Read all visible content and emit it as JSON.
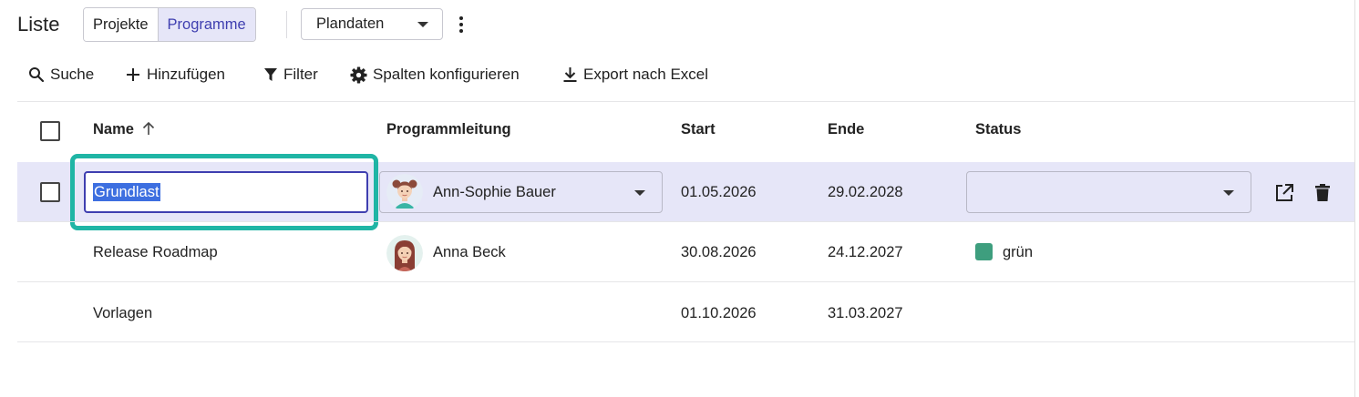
{
  "header": {
    "title": "Liste",
    "segments": [
      "Projekte",
      "Programme"
    ],
    "active_segment": "Programme",
    "view_select": "Plandaten"
  },
  "toolbar": {
    "search": "Suche",
    "add": "Hinzufügen",
    "filter": "Filter",
    "columns": "Spalten konfigurieren",
    "export": "Export nach Excel"
  },
  "table": {
    "columns": {
      "name": "Name",
      "lead": "Programmleitung",
      "start": "Start",
      "end": "Ende",
      "status": "Status"
    },
    "sort": {
      "column": "Name",
      "direction": "ascending"
    },
    "rows": [
      {
        "name": "Grundlast",
        "lead": "Ann-Sophie Bauer",
        "start": "01.05.2026",
        "end": "29.02.2028",
        "status": "",
        "editing": true
      },
      {
        "name": "Release Roadmap",
        "lead": "Anna Beck",
        "start": "30.08.2026",
        "end": "24.12.2027",
        "status": "grün",
        "editing": false
      },
      {
        "name": "Vorlagen",
        "lead": "",
        "start": "01.10.2026",
        "end": "31.03.2027",
        "status": "",
        "editing": false
      }
    ]
  },
  "colors": {
    "accent": "#3f3fb0",
    "selected_row": "#e6e6f8",
    "focus_ring": "#1fb5a5",
    "status_green": "#3e9e7e"
  },
  "icons": [
    "search-icon",
    "plus-icon",
    "filter-icon",
    "gear-icon",
    "download-icon",
    "sort-arrow-up-icon",
    "open-external-icon",
    "trash-icon",
    "kebab-menu-icon"
  ]
}
